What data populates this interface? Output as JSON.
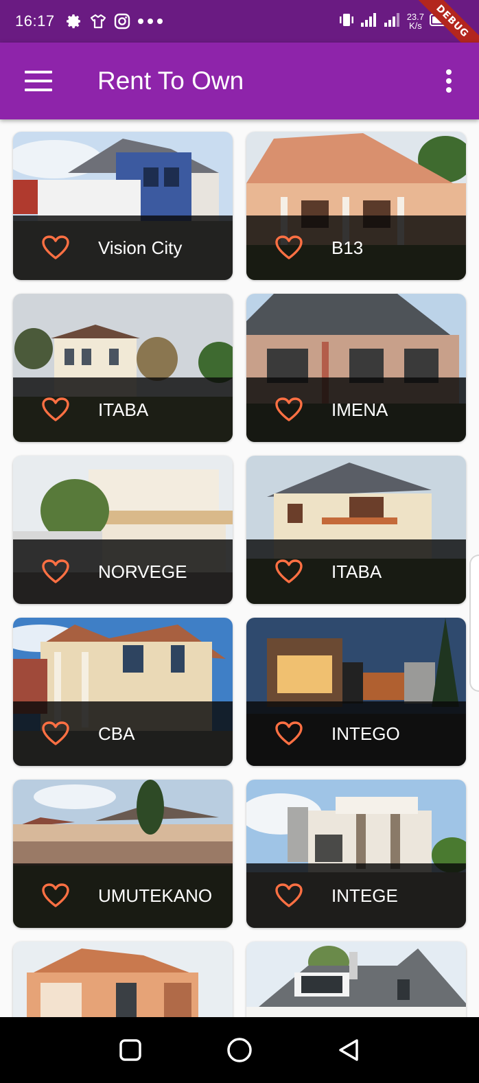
{
  "status_bar": {
    "time": "16:17",
    "net_speed_value": "23.7",
    "net_speed_unit": "K/s",
    "debug_label": "DEBUG",
    "icons": [
      "gear-icon",
      "tshirt-icon",
      "instagram-icon",
      "more-dots-icon",
      "vibrate-icon",
      "signal-icon",
      "signal-icon",
      "battery-icon"
    ]
  },
  "app_bar": {
    "title": "Rent To Own",
    "background": "#8e24aa",
    "status_background": "#6a1b82"
  },
  "heart_color": "#ff7043",
  "properties": [
    {
      "name": "Vision City"
    },
    {
      "name": "B13"
    },
    {
      "name": "ITABA"
    },
    {
      "name": "IMENA"
    },
    {
      "name": "NORVEGE"
    },
    {
      "name": "ITABA"
    },
    {
      "name": "CBA"
    },
    {
      "name": "INTEGO"
    },
    {
      "name": "UMUTEKANO"
    },
    {
      "name": "INTEGE"
    },
    {
      "name": ""
    },
    {
      "name": ""
    }
  ],
  "nav_bar": {
    "icons": [
      "recent-apps-icon",
      "home-icon",
      "back-icon"
    ]
  }
}
